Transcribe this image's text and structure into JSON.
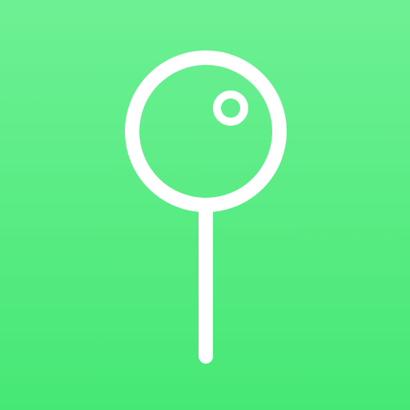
{
  "app_icon": {
    "icon": "map-pin-icon",
    "colors": {
      "background_top": "#6df094",
      "background_bottom": "#46e875",
      "glyph": "#ffffff"
    }
  }
}
